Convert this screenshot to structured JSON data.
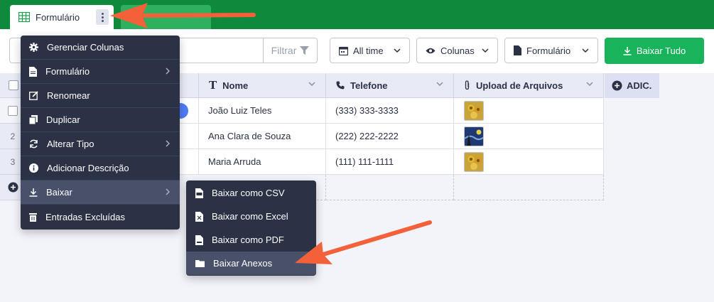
{
  "tabs": {
    "active_label": "Formulário"
  },
  "toolbar": {
    "filter_label": "Filtrar",
    "date_label": "All time",
    "columns_label": "Colunas",
    "form_label": "Formulário",
    "download_all_label": "Baixar Tudo"
  },
  "table": {
    "columns": [
      {
        "label": "Nome",
        "icon": "text-icon"
      },
      {
        "label": "Telefone",
        "icon": "phone-icon"
      },
      {
        "label": "Upload de Arquivos",
        "icon": "paperclip-icon"
      }
    ],
    "add_column_label": "ADIC.",
    "rows": [
      {
        "num": "",
        "name": "João Luiz Teles",
        "phone": "(333) 333-3333"
      },
      {
        "num": "2",
        "name": "Ana Clara de Souza",
        "phone": "(222) 222-2222"
      },
      {
        "num": "3",
        "name": "Maria Arruda",
        "phone": "(111) 111-1111"
      }
    ]
  },
  "menu": {
    "items": [
      {
        "label": "Gerenciar Colunas",
        "icon": "gear-icon"
      },
      {
        "label": "Formulário",
        "icon": "document-icon"
      },
      {
        "label": "Renomear",
        "icon": "edit-icon"
      },
      {
        "label": "Duplicar",
        "icon": "copy-icon"
      },
      {
        "label": "Alterar Tipo",
        "icon": "refresh-icon"
      },
      {
        "label": "Adicionar Descrição",
        "icon": "info-icon"
      },
      {
        "label": "Baixar",
        "icon": "download-icon"
      },
      {
        "label": "Entradas Excluídas",
        "icon": "trash-icon"
      }
    ]
  },
  "submenu": {
    "items": [
      {
        "label": "Baixar como CSV",
        "icon": "csv-file-icon"
      },
      {
        "label": "Baixar como Excel",
        "icon": "excel-file-icon"
      },
      {
        "label": "Baixar como PDF",
        "icon": "pdf-file-icon"
      },
      {
        "label": "Baixar Anexos",
        "icon": "folder-icon"
      }
    ]
  },
  "colors": {
    "brand_green": "#0f8a3c",
    "button_green": "#18b35a",
    "menu_bg": "#2b3245",
    "annotation_arrow": "#f2613a"
  }
}
